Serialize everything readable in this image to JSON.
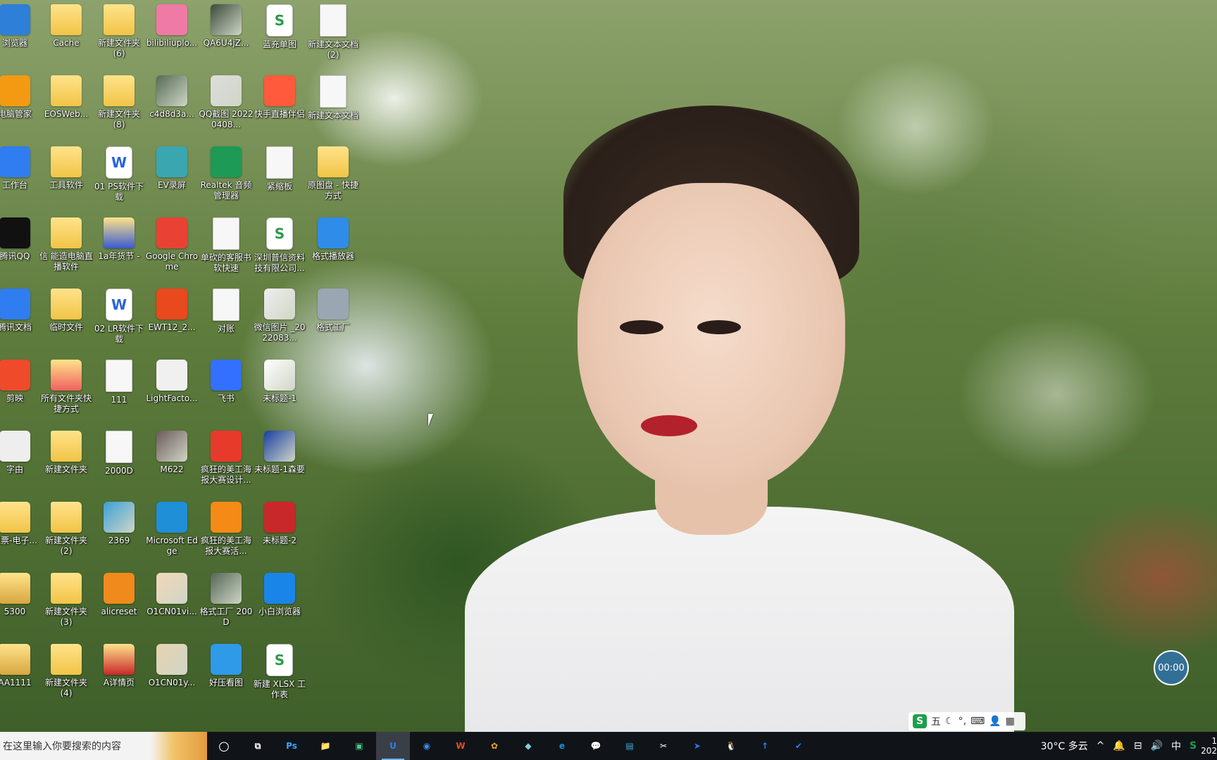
{
  "desktop": {
    "icons": [
      {
        "label": "浏览器",
        "icon": "globe-icon",
        "color": "#2d7fd8",
        "col": 0,
        "row": 0,
        "type": "app"
      },
      {
        "label": "Cache",
        "icon": "folder-icon",
        "color": "#f1c447",
        "col": 1,
        "row": 0,
        "type": "folder"
      },
      {
        "label": "新建文件夹 (6)",
        "icon": "folder-icon",
        "color": "#f1c447",
        "col": 2,
        "row": 0,
        "type": "folder"
      },
      {
        "label": "bilibiliuplo...",
        "icon": "bilibili-icon",
        "color": "#f07aa6",
        "col": 3,
        "row": 0,
        "type": "app"
      },
      {
        "label": "QA6U4jZ...",
        "icon": "video-thumb-icon",
        "color": "#3b4a3b",
        "col": 4,
        "row": 0,
        "type": "image"
      },
      {
        "label": "蓝充单图",
        "icon": "sheet-icon",
        "color": "#2e9a4a",
        "col": 5,
        "row": 0,
        "type": "sheet"
      },
      {
        "label": "新建文本文档 (2)",
        "icon": "text-doc-icon",
        "color": "#cccccc",
        "col": 6,
        "row": 0,
        "type": "doc"
      },
      {
        "label": "电脑管家",
        "icon": "lightning-icon",
        "color": "#f39a12",
        "col": 0,
        "row": 1,
        "type": "app"
      },
      {
        "label": "EOSWeb...",
        "icon": "folder-icon",
        "color": "#f1c447",
        "col": 1,
        "row": 1,
        "type": "folder"
      },
      {
        "label": "新建文件夹 (8)",
        "icon": "folder-icon",
        "color": "#f1c447",
        "col": 2,
        "row": 1,
        "type": "folder"
      },
      {
        "label": "c4d8d3a...",
        "icon": "image-thumb-icon",
        "color": "#556b55",
        "col": 3,
        "row": 1,
        "type": "image"
      },
      {
        "label": "QQ截图 20220408...",
        "icon": "image-thumb-icon",
        "color": "#dddddd",
        "col": 4,
        "row": 1,
        "type": "image"
      },
      {
        "label": "快手直播伴侣",
        "icon": "kuaishou-icon",
        "color": "#ff5a3c",
        "col": 5,
        "row": 1,
        "type": "app"
      },
      {
        "label": "新建文本文档",
        "icon": "text-doc-icon",
        "color": "#cccccc",
        "col": 6,
        "row": 1,
        "type": "doc"
      },
      {
        "label": "工作台",
        "icon": "uu-icon",
        "color": "#2f7df0",
        "col": 0,
        "row": 2,
        "type": "app"
      },
      {
        "label": "工具软件",
        "icon": "folder-icon",
        "color": "#f1c447",
        "col": 1,
        "row": 2,
        "type": "folder"
      },
      {
        "label": "01 PS软件下载",
        "icon": "word-icon",
        "color": "#2b63d9",
        "col": 2,
        "row": 2,
        "type": "word"
      },
      {
        "label": "EV录屏",
        "icon": "ev-icon",
        "color": "#3aa6b0",
        "col": 3,
        "row": 2,
        "type": "app"
      },
      {
        "label": "Realtek 音频管理器",
        "icon": "speaker-icon",
        "color": "#1d9a55",
        "col": 4,
        "row": 2,
        "type": "app"
      },
      {
        "label": "紧缩板",
        "icon": "spreadsheet-thumb-icon",
        "color": "#ffffff",
        "col": 5,
        "row": 2,
        "type": "doc"
      },
      {
        "label": "原图盘 - 快捷方式",
        "icon": "folder-icon",
        "color": "#f1c447",
        "col": 6,
        "row": 2,
        "type": "folder"
      },
      {
        "label": "腾讯QQ",
        "icon": "qq-penguin-icon",
        "color": "#111111",
        "col": 0,
        "row": 3,
        "type": "app"
      },
      {
        "label": "信 能造电脑直播软件",
        "icon": "folder-icon",
        "color": "#f1c447",
        "col": 1,
        "row": 3,
        "type": "folder"
      },
      {
        "label": "1a年货节 -",
        "icon": "folder-icon",
        "color": "#3a5bd0",
        "col": 2,
        "row": 3,
        "type": "folder"
      },
      {
        "label": "Google Chrome",
        "icon": "chrome-icon",
        "color": "#e94235",
        "col": 3,
        "row": 3,
        "type": "app"
      },
      {
        "label": "单砍的客服书软快速",
        "icon": "text-doc-icon",
        "color": "#cccccc",
        "col": 4,
        "row": 3,
        "type": "doc"
      },
      {
        "label": "深圳普信资料技有限公司...",
        "icon": "sheet-icon",
        "color": "#2e9a4a",
        "col": 5,
        "row": 3,
        "type": "sheet"
      },
      {
        "label": "格式播放器",
        "icon": "video-player-icon",
        "color": "#2f8ce8",
        "col": 6,
        "row": 3,
        "type": "app"
      },
      {
        "label": "腾讯文档",
        "icon": "tencent-docs-icon",
        "color": "#2f7df0",
        "col": 0,
        "row": 4,
        "type": "app"
      },
      {
        "label": "临时文件",
        "icon": "folder-icon",
        "color": "#f1c447",
        "col": 1,
        "row": 4,
        "type": "folder"
      },
      {
        "label": "02 LR软件下载",
        "icon": "word-icon",
        "color": "#2b63d9",
        "col": 2,
        "row": 4,
        "type": "word"
      },
      {
        "label": "EWT12_2...",
        "icon": "wps-icon",
        "color": "#e8491d",
        "col": 3,
        "row": 4,
        "type": "app"
      },
      {
        "label": "对账",
        "icon": "spreadsheet-thumb-icon",
        "color": "#ffffff",
        "col": 4,
        "row": 4,
        "type": "doc"
      },
      {
        "label": "微信图片 _2022083...",
        "icon": "image-thumb-icon",
        "color": "#eeeeee",
        "col": 5,
        "row": 4,
        "type": "image"
      },
      {
        "label": "格式工厂",
        "icon": "format-factory-icon",
        "color": "#9aa6b2",
        "col": 6,
        "row": 4,
        "type": "app"
      },
      {
        "label": "剪映",
        "icon": "play-icon",
        "color": "#ef4a2a",
        "col": 0,
        "row": 5,
        "type": "app"
      },
      {
        "label": "所有文件夹快捷方式",
        "icon": "folder-icon",
        "color": "#f06060",
        "col": 1,
        "row": 5,
        "type": "folder"
      },
      {
        "label": "111",
        "icon": "text-doc-icon",
        "color": "#cccccc",
        "col": 2,
        "row": 5,
        "type": "doc"
      },
      {
        "label": "LightFacto...",
        "icon": "plugin-icon",
        "color": "#f0f0f0",
        "col": 3,
        "row": 5,
        "type": "app"
      },
      {
        "label": "飞书",
        "icon": "feishu-icon",
        "color": "#3370ff",
        "col": 4,
        "row": 5,
        "type": "app"
      },
      {
        "label": "未标题-1",
        "icon": "image-thumb-icon",
        "color": "#ffffff",
        "col": 5,
        "row": 5,
        "type": "image"
      },
      {
        "label": "字由",
        "icon": "pen-icon",
        "color": "#eeeeee",
        "col": 0,
        "row": 6,
        "type": "app"
      },
      {
        "label": "新建文件夹",
        "icon": "folder-icon",
        "color": "#f1c447",
        "col": 1,
        "row": 6,
        "type": "folder"
      },
      {
        "label": "2000D",
        "icon": "text-doc-icon",
        "color": "#cccccc",
        "col": 2,
        "row": 6,
        "type": "doc"
      },
      {
        "label": "M622",
        "icon": "video-thumb-icon",
        "color": "#6c5a5a",
        "col": 3,
        "row": 6,
        "type": "image"
      },
      {
        "label": "疯狂的美工海报大赛设计...",
        "icon": "red-yellow-app-icon",
        "color": "#e83a2a",
        "col": 4,
        "row": 6,
        "type": "app"
      },
      {
        "label": "未标题-1森要",
        "icon": "psd-icon",
        "color": "#1a3fa3",
        "col": 5,
        "row": 6,
        "type": "image"
      },
      {
        "label": "发票-电子...",
        "icon": "folder-icon",
        "color": "#f1c447",
        "col": 0,
        "row": 7,
        "type": "folder"
      },
      {
        "label": "新建文件夹 (2)",
        "icon": "folder-icon",
        "color": "#f1c447",
        "col": 1,
        "row": 7,
        "type": "folder"
      },
      {
        "label": "2369",
        "icon": "image-thumb-icon",
        "color": "#3aa0d8",
        "col": 2,
        "row": 7,
        "type": "image"
      },
      {
        "label": "Microsoft Edge",
        "icon": "edge-icon",
        "color": "#1f8fd8",
        "col": 3,
        "row": 7,
        "type": "app"
      },
      {
        "label": "疯狂的美工海报大赛活...",
        "icon": "red-yellow-app-icon",
        "color": "#f58a16",
        "col": 4,
        "row": 7,
        "type": "app"
      },
      {
        "label": "未标题-2",
        "icon": "red-logo-icon",
        "color": "#c8282a",
        "col": 5,
        "row": 7,
        "type": "app"
      },
      {
        "label": "5300",
        "icon": "folder-icon",
        "color": "#d8a640",
        "col": 0,
        "row": 8,
        "type": "folder"
      },
      {
        "label": "新建文件夹 (3)",
        "icon": "folder-icon",
        "color": "#f1c447",
        "col": 1,
        "row": 8,
        "type": "folder"
      },
      {
        "label": "alicreset",
        "icon": "alipay-shield-icon",
        "color": "#f08a1c",
        "col": 2,
        "row": 8,
        "type": "app"
      },
      {
        "label": "O1CN01vi...",
        "icon": "image-thumb-icon",
        "color": "#f3d7b8",
        "col": 3,
        "row": 8,
        "type": "image"
      },
      {
        "label": "格式工厂 200D",
        "icon": "video-thumb-icon",
        "color": "#556655",
        "col": 4,
        "row": 8,
        "type": "image"
      },
      {
        "label": "小白浏览器",
        "icon": "xiaobai-browser-icon",
        "color": "#1a85e8",
        "col": 5,
        "row": 8,
        "type": "app"
      },
      {
        "label": "AA1111",
        "icon": "folder-icon",
        "color": "#d8a640",
        "col": 0,
        "row": 9,
        "type": "folder"
      },
      {
        "label": "新建文件夹 (4)",
        "icon": "folder-icon",
        "color": "#f1c447",
        "col": 1,
        "row": 9,
        "type": "folder"
      },
      {
        "label": "A详情页",
        "icon": "folder-icon",
        "color": "#c8282a",
        "col": 2,
        "row": 9,
        "type": "folder"
      },
      {
        "label": "O1CN01y...",
        "icon": "image-thumb-icon",
        "color": "#e8d2b0",
        "col": 3,
        "row": 9,
        "type": "image"
      },
      {
        "label": "好压看图",
        "icon": "haozip-viewer-icon",
        "color": "#2f9ae8",
        "col": 4,
        "row": 9,
        "type": "app"
      },
      {
        "label": "新建 XLSX 工作表",
        "icon": "sheet-icon",
        "color": "#2e9a4a",
        "col": 5,
        "row": 9,
        "type": "sheet"
      }
    ]
  },
  "timer": {
    "text": "00:00"
  },
  "ime_bar": {
    "logo": "S",
    "mode": "五",
    "items": [
      "☾",
      "°,",
      "⌨",
      "👤",
      "▦"
    ]
  },
  "taskbar": {
    "search_placeholder": "在这里输入你要搜索的内容",
    "task_view_icon": "○",
    "apps": [
      {
        "name": "task-view",
        "glyph": "⧉",
        "color": "#ffffff",
        "active": false
      },
      {
        "name": "photoshop",
        "glyph": "Ps",
        "color": "#31a8ff",
        "active": false
      },
      {
        "name": "file-explorer",
        "glyph": "📁",
        "color": "#f1c447",
        "active": false
      },
      {
        "name": "photos",
        "glyph": "▣",
        "color": "#4ec58a",
        "active": false
      },
      {
        "name": "uu-workbench",
        "glyph": "U",
        "color": "#2f7df0",
        "active": true
      },
      {
        "name": "browser",
        "glyph": "◉",
        "color": "#3b8ee8",
        "active": false
      },
      {
        "name": "wps",
        "glyph": "W",
        "color": "#e8491d",
        "active": false
      },
      {
        "name": "pinwheel",
        "glyph": "✿",
        "color": "#f0a030",
        "active": false
      },
      {
        "name": "notes",
        "glyph": "◆",
        "color": "#7fd0e0",
        "active": false
      },
      {
        "name": "edge",
        "glyph": "e",
        "color": "#1f8fd8",
        "active": false
      },
      {
        "name": "wechat",
        "glyph": "💬",
        "color": "#2aae67",
        "active": false
      },
      {
        "name": "store",
        "glyph": "▤",
        "color": "#3fb0e0",
        "active": false
      },
      {
        "name": "capcut",
        "glyph": "✂",
        "color": "#ffffff",
        "active": false
      },
      {
        "name": "feishu",
        "glyph": "➤",
        "color": "#3370ff",
        "active": false
      },
      {
        "name": "qq",
        "glyph": "🐧",
        "color": "#ffffff",
        "active": false
      },
      {
        "name": "tencent-docs",
        "glyph": "↑",
        "color": "#2f7df0",
        "active": false
      },
      {
        "name": "security",
        "glyph": "✔",
        "color": "#2f7df0",
        "active": false
      }
    ],
    "tray": {
      "weather": "30°C 多云",
      "chevron": "^",
      "icons": [
        "🔔",
        "⊟",
        "🔊"
      ],
      "ime": "中",
      "sogou": "S",
      "clock_top": "1",
      "clock_bottom": "202"
    }
  }
}
